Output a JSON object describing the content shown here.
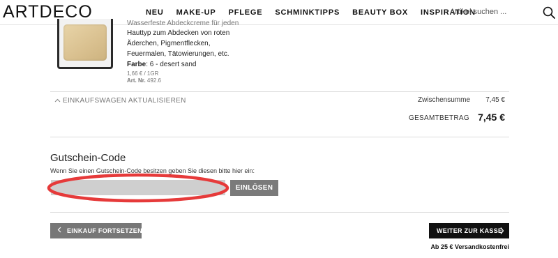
{
  "header": {
    "logo": "ARTDECO",
    "nav": [
      "NEU",
      "MAKE-UP",
      "PFLEGE",
      "SCHMINKTIPPS",
      "BEAUTY BOX",
      "INSPIRATION"
    ],
    "search_placeholder": "Artikel suchen ...",
    "search_icon": "magnifier-icon"
  },
  "product": {
    "description_lines": [
      "Wasserfeste Abdeckcreme für jeden",
      "Hauttyp zum Abdecken von roten",
      "Äderchen, Pigmentflecken,",
      "Feuermalen, Tätowierungen, etc."
    ],
    "color_label": "Farbe",
    "color_value": ": 6 - desert sand",
    "unit_price": "1,66 € / 1GR",
    "article_label": "Art. Nr.",
    "article_number": "492.6"
  },
  "cart": {
    "update_label": "EINKAUFSWAGEN AKTUALISIEREN",
    "subtotal_label": "Zwischensumme",
    "subtotal_value": "7,45 €",
    "total_label": "GESAMTBETRAG",
    "total_value": "7,45 €"
  },
  "coupon": {
    "title": "Gutschein-Code",
    "hint": "Wenn Sie einen Gutschein-Code besitzen geben Sie diesen bitte hier ein:",
    "input_value": "",
    "redeem_label": "EINLÖSEN",
    "highlight_color": "#e63a3a"
  },
  "footer": {
    "continue_label": "EINKAUF FORTSETZEN",
    "checkout_label": "WEITER ZUR KASSE",
    "shipping_note": "Ab 25 € Versandkostenfrei"
  }
}
